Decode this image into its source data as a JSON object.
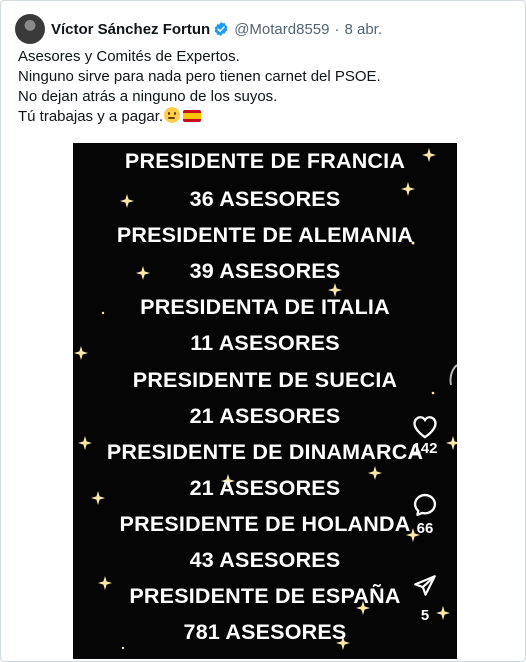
{
  "tweet": {
    "author_name": "Víctor Sánchez Fortun",
    "handle": "@Motard8559",
    "separator": "·",
    "date": "8 abr.",
    "lines": [
      "Asesores y Comités de Expertos.",
      "Ninguno sirve para nada pero tienen carnet del PSOE.",
      "No dejan atrás a ninguno de los suyos.",
      "Tú trabajas y a pagar."
    ],
    "emojis": [
      "thinking-face",
      "spain-flag"
    ]
  },
  "image": {
    "lines": [
      "PRESIDENTE DE FRANCIA",
      "36 ASESORES",
      "PRESIDENTE DE ALEMANIA",
      "39 ASESORES",
      "PRESIDENTA DE ITALIA",
      "11 ASESORES",
      "PRESIDENTE DE SUECIA",
      "21 ASESORES",
      "PRESIDENTE DE DINAMARCA",
      "21 ASESORES",
      "PRESIDENTE DE HOLANDA",
      "43 ASESORES",
      "PRESIDENTE DE ESPAÑA",
      "781 ASESORES"
    ],
    "side_actions": {
      "likes": "142",
      "comments": "66",
      "shares": "5"
    }
  },
  "colors": {
    "verified_blue": "#1d9bf0",
    "text": "#0f1419",
    "secondary": "#536471",
    "image_bg": "#050505"
  }
}
